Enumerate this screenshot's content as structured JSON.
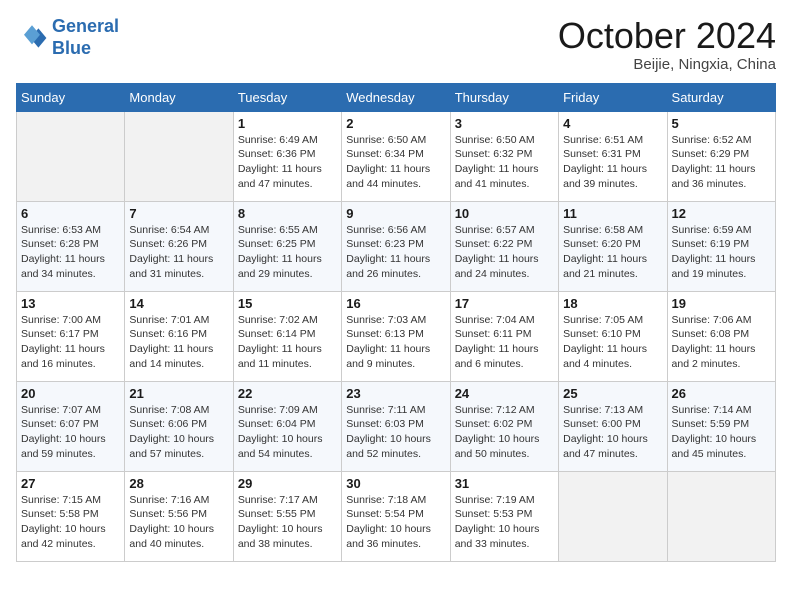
{
  "header": {
    "logo_line1": "General",
    "logo_line2": "Blue",
    "month": "October 2024",
    "location": "Beijie, Ningxia, China"
  },
  "weekdays": [
    "Sunday",
    "Monday",
    "Tuesday",
    "Wednesday",
    "Thursday",
    "Friday",
    "Saturday"
  ],
  "weeks": [
    [
      {
        "day": "",
        "empty": true
      },
      {
        "day": "",
        "empty": true
      },
      {
        "day": "1",
        "sunrise": "Sunrise: 6:49 AM",
        "sunset": "Sunset: 6:36 PM",
        "daylight": "Daylight: 11 hours and 47 minutes."
      },
      {
        "day": "2",
        "sunrise": "Sunrise: 6:50 AM",
        "sunset": "Sunset: 6:34 PM",
        "daylight": "Daylight: 11 hours and 44 minutes."
      },
      {
        "day": "3",
        "sunrise": "Sunrise: 6:50 AM",
        "sunset": "Sunset: 6:32 PM",
        "daylight": "Daylight: 11 hours and 41 minutes."
      },
      {
        "day": "4",
        "sunrise": "Sunrise: 6:51 AM",
        "sunset": "Sunset: 6:31 PM",
        "daylight": "Daylight: 11 hours and 39 minutes."
      },
      {
        "day": "5",
        "sunrise": "Sunrise: 6:52 AM",
        "sunset": "Sunset: 6:29 PM",
        "daylight": "Daylight: 11 hours and 36 minutes."
      }
    ],
    [
      {
        "day": "6",
        "sunrise": "Sunrise: 6:53 AM",
        "sunset": "Sunset: 6:28 PM",
        "daylight": "Daylight: 11 hours and 34 minutes."
      },
      {
        "day": "7",
        "sunrise": "Sunrise: 6:54 AM",
        "sunset": "Sunset: 6:26 PM",
        "daylight": "Daylight: 11 hours and 31 minutes."
      },
      {
        "day": "8",
        "sunrise": "Sunrise: 6:55 AM",
        "sunset": "Sunset: 6:25 PM",
        "daylight": "Daylight: 11 hours and 29 minutes."
      },
      {
        "day": "9",
        "sunrise": "Sunrise: 6:56 AM",
        "sunset": "Sunset: 6:23 PM",
        "daylight": "Daylight: 11 hours and 26 minutes."
      },
      {
        "day": "10",
        "sunrise": "Sunrise: 6:57 AM",
        "sunset": "Sunset: 6:22 PM",
        "daylight": "Daylight: 11 hours and 24 minutes."
      },
      {
        "day": "11",
        "sunrise": "Sunrise: 6:58 AM",
        "sunset": "Sunset: 6:20 PM",
        "daylight": "Daylight: 11 hours and 21 minutes."
      },
      {
        "day": "12",
        "sunrise": "Sunrise: 6:59 AM",
        "sunset": "Sunset: 6:19 PM",
        "daylight": "Daylight: 11 hours and 19 minutes."
      }
    ],
    [
      {
        "day": "13",
        "sunrise": "Sunrise: 7:00 AM",
        "sunset": "Sunset: 6:17 PM",
        "daylight": "Daylight: 11 hours and 16 minutes."
      },
      {
        "day": "14",
        "sunrise": "Sunrise: 7:01 AM",
        "sunset": "Sunset: 6:16 PM",
        "daylight": "Daylight: 11 hours and 14 minutes."
      },
      {
        "day": "15",
        "sunrise": "Sunrise: 7:02 AM",
        "sunset": "Sunset: 6:14 PM",
        "daylight": "Daylight: 11 hours and 11 minutes."
      },
      {
        "day": "16",
        "sunrise": "Sunrise: 7:03 AM",
        "sunset": "Sunset: 6:13 PM",
        "daylight": "Daylight: 11 hours and 9 minutes."
      },
      {
        "day": "17",
        "sunrise": "Sunrise: 7:04 AM",
        "sunset": "Sunset: 6:11 PM",
        "daylight": "Daylight: 11 hours and 6 minutes."
      },
      {
        "day": "18",
        "sunrise": "Sunrise: 7:05 AM",
        "sunset": "Sunset: 6:10 PM",
        "daylight": "Daylight: 11 hours and 4 minutes."
      },
      {
        "day": "19",
        "sunrise": "Sunrise: 7:06 AM",
        "sunset": "Sunset: 6:08 PM",
        "daylight": "Daylight: 11 hours and 2 minutes."
      }
    ],
    [
      {
        "day": "20",
        "sunrise": "Sunrise: 7:07 AM",
        "sunset": "Sunset: 6:07 PM",
        "daylight": "Daylight: 10 hours and 59 minutes."
      },
      {
        "day": "21",
        "sunrise": "Sunrise: 7:08 AM",
        "sunset": "Sunset: 6:06 PM",
        "daylight": "Daylight: 10 hours and 57 minutes."
      },
      {
        "day": "22",
        "sunrise": "Sunrise: 7:09 AM",
        "sunset": "Sunset: 6:04 PM",
        "daylight": "Daylight: 10 hours and 54 minutes."
      },
      {
        "day": "23",
        "sunrise": "Sunrise: 7:11 AM",
        "sunset": "Sunset: 6:03 PM",
        "daylight": "Daylight: 10 hours and 52 minutes."
      },
      {
        "day": "24",
        "sunrise": "Sunrise: 7:12 AM",
        "sunset": "Sunset: 6:02 PM",
        "daylight": "Daylight: 10 hours and 50 minutes."
      },
      {
        "day": "25",
        "sunrise": "Sunrise: 7:13 AM",
        "sunset": "Sunset: 6:00 PM",
        "daylight": "Daylight: 10 hours and 47 minutes."
      },
      {
        "day": "26",
        "sunrise": "Sunrise: 7:14 AM",
        "sunset": "Sunset: 5:59 PM",
        "daylight": "Daylight: 10 hours and 45 minutes."
      }
    ],
    [
      {
        "day": "27",
        "sunrise": "Sunrise: 7:15 AM",
        "sunset": "Sunset: 5:58 PM",
        "daylight": "Daylight: 10 hours and 42 minutes."
      },
      {
        "day": "28",
        "sunrise": "Sunrise: 7:16 AM",
        "sunset": "Sunset: 5:56 PM",
        "daylight": "Daylight: 10 hours and 40 minutes."
      },
      {
        "day": "29",
        "sunrise": "Sunrise: 7:17 AM",
        "sunset": "Sunset: 5:55 PM",
        "daylight": "Daylight: 10 hours and 38 minutes."
      },
      {
        "day": "30",
        "sunrise": "Sunrise: 7:18 AM",
        "sunset": "Sunset: 5:54 PM",
        "daylight": "Daylight: 10 hours and 36 minutes."
      },
      {
        "day": "31",
        "sunrise": "Sunrise: 7:19 AM",
        "sunset": "Sunset: 5:53 PM",
        "daylight": "Daylight: 10 hours and 33 minutes."
      },
      {
        "day": "",
        "empty": true
      },
      {
        "day": "",
        "empty": true
      }
    ]
  ]
}
